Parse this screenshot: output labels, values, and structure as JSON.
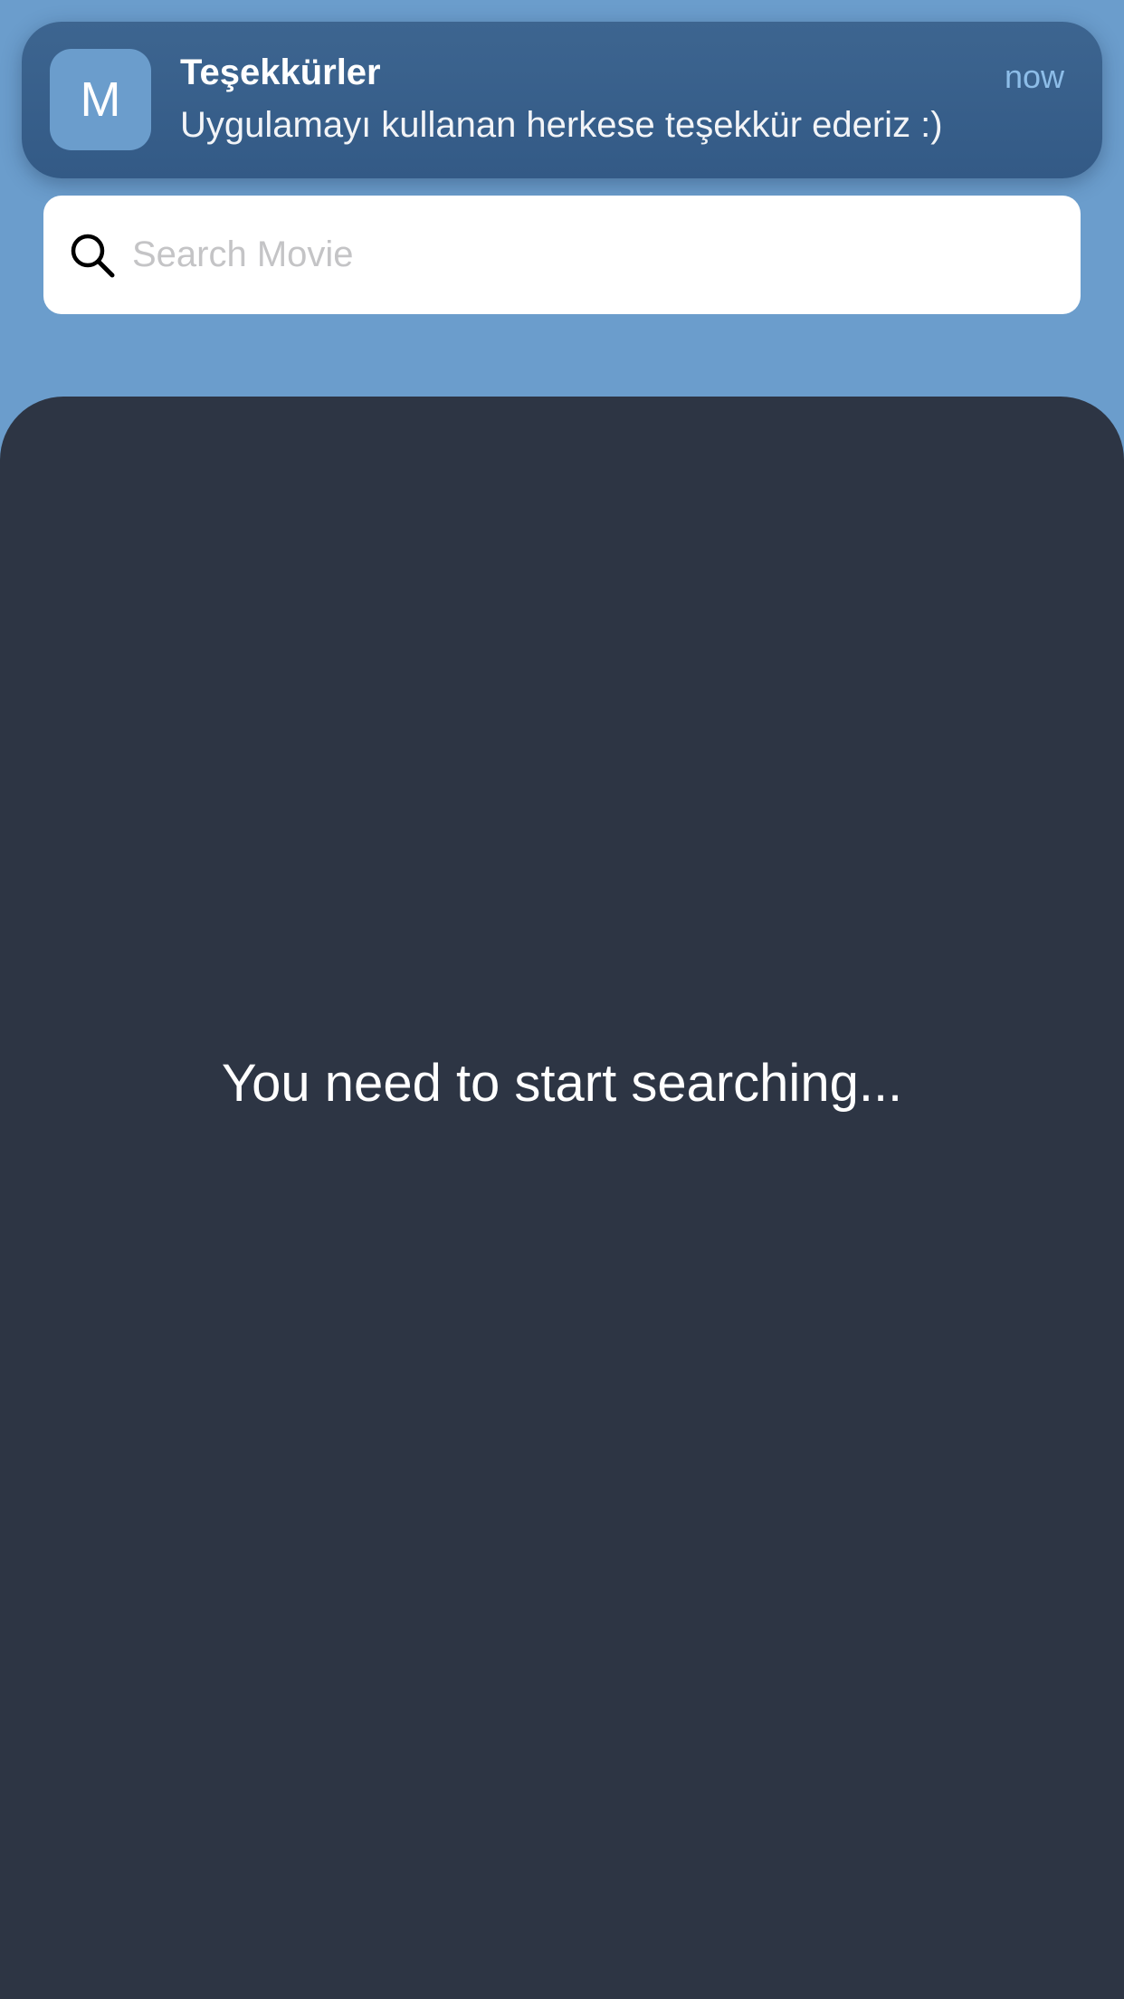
{
  "notification": {
    "app_icon_letter": "M",
    "title": "Teşekkürler",
    "time": "now",
    "body": "Uygulamayı kullanan herkese teşekkür ederiz :)",
    "icon": "app-icon"
  },
  "search": {
    "placeholder": "Search Movie",
    "value": "",
    "icon": "search-icon"
  },
  "content": {
    "empty_message": "You need to start searching..."
  },
  "colors": {
    "background_top": "#6b9dcc",
    "notification_bg": "#3a6290",
    "panel_bg": "#2d3544",
    "time_text": "#8dbde8",
    "placeholder": "#c4c4c6"
  }
}
